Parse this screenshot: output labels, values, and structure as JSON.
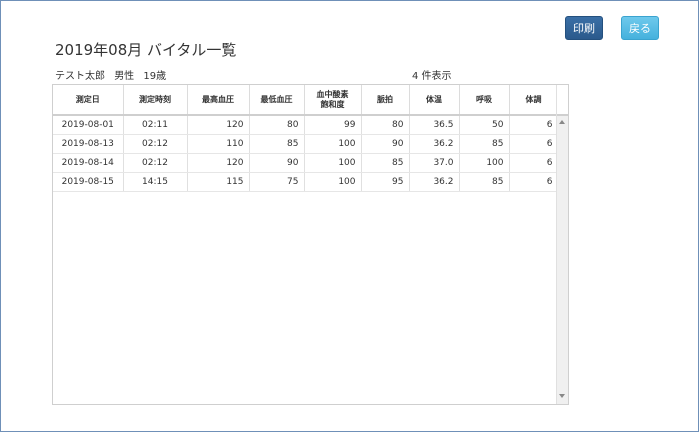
{
  "toolbar": {
    "print_label": "印刷",
    "back_label": "戻る"
  },
  "header": {
    "title": "2019年08月  バイタル一覧"
  },
  "patient": {
    "name": "テスト太郎",
    "gender": "男性",
    "age": "19歳"
  },
  "summary": {
    "count_text": "4 件表示"
  },
  "table": {
    "headers": [
      "測定日",
      "測定時刻",
      "最高血圧",
      "最低血圧",
      "血中酸素\n飽和度",
      "脈拍",
      "体温",
      "呼吸",
      "体調"
    ],
    "rows": [
      [
        "2019-08-01",
        "02:11",
        "120",
        "80",
        "99",
        "80",
        "36.5",
        "50",
        "6"
      ],
      [
        "2019-08-13",
        "02:12",
        "110",
        "85",
        "100",
        "90",
        "36.2",
        "85",
        "6"
      ],
      [
        "2019-08-14",
        "02:12",
        "120",
        "90",
        "100",
        "85",
        "37.0",
        "100",
        "6"
      ],
      [
        "2019-08-15",
        "14:15",
        "115",
        "75",
        "100",
        "95",
        "36.2",
        "85",
        "6"
      ]
    ]
  },
  "colors": {
    "print_button": "#2b5a8c",
    "back_button": "#45b1dd",
    "frame_border": "#6f90b8"
  }
}
